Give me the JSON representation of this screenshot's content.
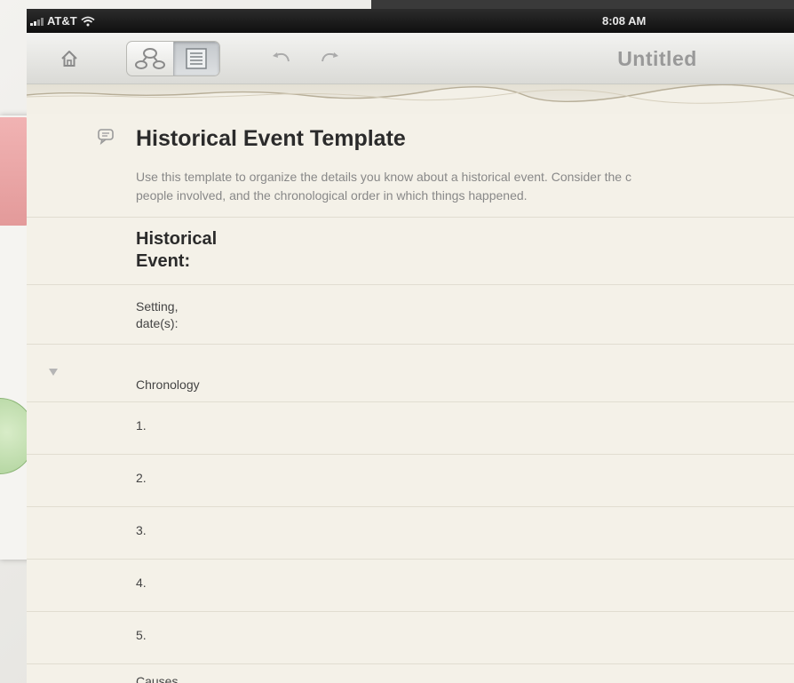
{
  "status_bar": {
    "carrier": "AT&T",
    "time": "8:08 AM"
  },
  "toolbar": {
    "title": "Untitled",
    "icons": [
      "home-icon",
      "outline-view-icon",
      "list-view-icon",
      "undo-icon",
      "redo-icon"
    ]
  },
  "document": {
    "title": "Historical Event Template",
    "description_line1": "Use this template to organize the details you know about a historical event. Consider the c",
    "description_line2": "people involved, and the chronological order in which things happened.",
    "event_label_line1": "Historical",
    "event_label_line2": "Event:",
    "setting_label_line1": "Setting,",
    "setting_label_line2": "date(s):",
    "chronology_label": "Chronology",
    "chronology_items": [
      "1.",
      "2.",
      "3.",
      "4.",
      "5."
    ],
    "next_section_label": "Causes"
  },
  "colors": {
    "accent_pink": "#e9a5a5",
    "accent_green": "#bfe0ac",
    "paper": "#f4f1e8"
  }
}
